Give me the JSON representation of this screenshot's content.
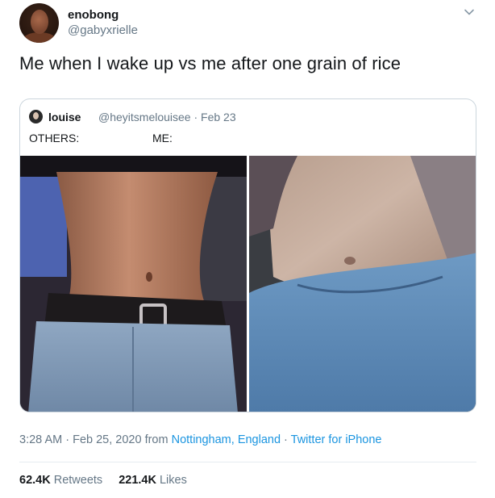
{
  "author": {
    "display_name": "enobong",
    "handle": "@gabyxrielle"
  },
  "tweet": {
    "text": "Me when I wake up vs me after one grain of rice"
  },
  "quoted_tweet": {
    "display_name": "louise",
    "meta": "@heyitsmelouisee · Feb 23",
    "line_left": "OTHERS:",
    "line_right": "ME:"
  },
  "footer": {
    "time": "3:28 AM · Feb 25, 2020 from ",
    "location": "Nottingham, England",
    "sep": " · ",
    "source": "Twitter for iPhone"
  },
  "stats": {
    "retweets_count": "62.4K",
    "retweets_label": "Retweets",
    "likes_count": "221.4K",
    "likes_label": "Likes"
  },
  "icons": {
    "chevron": "chevron-down-icon"
  }
}
